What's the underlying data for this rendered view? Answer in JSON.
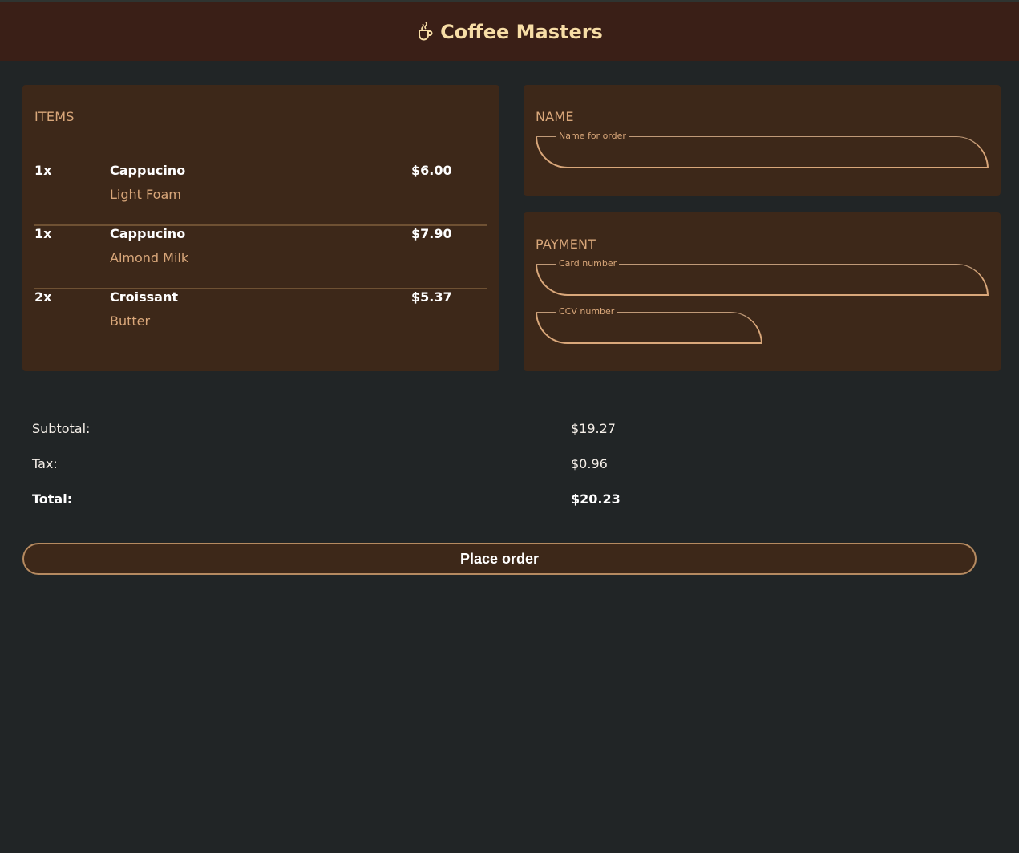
{
  "app": {
    "title": "Coffee Masters",
    "brand_icon": "coffee-cup-icon",
    "colors": {
      "background": "#212526",
      "header": "#3a1f17",
      "card": "#3d2819",
      "accent": "#d9a77a",
      "brand_text": "#f7dda6"
    }
  },
  "items_section": {
    "title": "ITEMS",
    "items": [
      {
        "qty": "1x",
        "name": "Cappucino",
        "note": "Light Foam",
        "price": "$6.00"
      },
      {
        "qty": "1x",
        "name": "Cappucino",
        "note": "Almond Milk",
        "price": "$7.90"
      },
      {
        "qty": "2x",
        "name": "Croissant",
        "note": "Butter",
        "price": "$5.37"
      }
    ]
  },
  "name_section": {
    "title": "NAME",
    "name_field": {
      "label": "Name for order",
      "value": ""
    }
  },
  "payment_section": {
    "title": "PAYMENT",
    "card_field": {
      "label": "Card number",
      "value": ""
    },
    "ccv_field": {
      "label": "CCV number",
      "value": ""
    }
  },
  "totals": {
    "subtotal_label": "Subtotal:",
    "subtotal_value": "$19.27",
    "tax_label": "Tax:",
    "tax_value": "$0.96",
    "total_label": "Total:",
    "total_value": "$20.23"
  },
  "actions": {
    "place_order_label": "Place order"
  }
}
